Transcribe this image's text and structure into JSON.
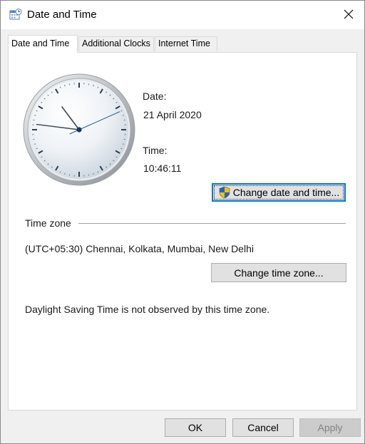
{
  "window": {
    "title": "Date and Time"
  },
  "tabs": [
    {
      "label": "Date and Time"
    },
    {
      "label": "Additional Clocks"
    },
    {
      "label": "Internet Time"
    }
  ],
  "datetime": {
    "date_label": "Date:",
    "date_value": "21 April 2020",
    "time_label": "Time:",
    "time_value": "10:46:11",
    "change_button": "Change date and time..."
  },
  "clock": {
    "hours": 10,
    "minutes": 46,
    "seconds": 11
  },
  "timezone": {
    "group_label": "Time zone",
    "value": "(UTC+05:30) Chennai, Kolkata, Mumbai, New Delhi",
    "change_button": "Change time zone...",
    "dst_note": "Daylight Saving Time is not observed by this time zone."
  },
  "footer": {
    "ok": "OK",
    "cancel": "Cancel",
    "apply": "Apply"
  },
  "icons": {
    "app": "date-time-icon",
    "close": "close-icon",
    "shield": "uac-shield-icon"
  },
  "colors": {
    "accent": "#0078d7"
  }
}
